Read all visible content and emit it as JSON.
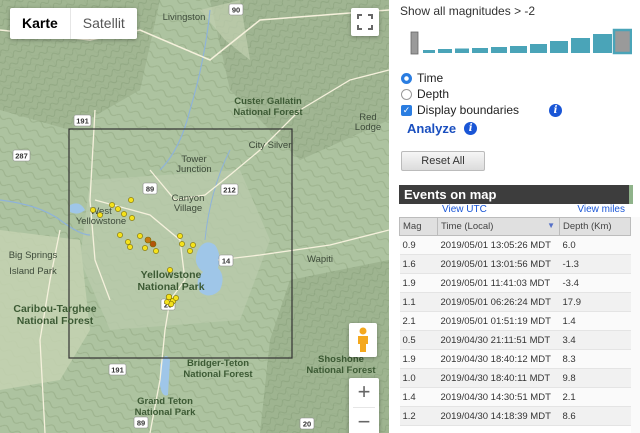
{
  "map": {
    "map_type_buttons": [
      "Karte",
      "Satellit"
    ],
    "active_map_type": "Karte",
    "labels": [
      {
        "name": "livingston",
        "text": "Livingston"
      },
      {
        "name": "gallatin",
        "text": "Custer Gallatin\nNational Forest"
      },
      {
        "name": "red-lodge",
        "text": "Red\nLodge"
      },
      {
        "name": "city-silver",
        "text": "City Silver"
      },
      {
        "name": "tower-junction",
        "text": "Tower\nJunction"
      },
      {
        "name": "canyon-village",
        "text": "Canyon\nVillage"
      },
      {
        "name": "west-yellowstone",
        "text": "West\nYellowstone"
      },
      {
        "name": "big-springs",
        "text": "Big Springs"
      },
      {
        "name": "island-park",
        "text": "Island Park"
      },
      {
        "name": "yellowstone-np",
        "text": "Yellowstone\nNational Park"
      },
      {
        "name": "caribou-targhee",
        "text": "Caribou-Targhee\nNational Forest"
      },
      {
        "name": "wapiti",
        "text": "Wapiti"
      },
      {
        "name": "shoshone",
        "text": "Shoshone\nNational Forest"
      },
      {
        "name": "bridger-teton",
        "text": "Bridger-Teton\nNational Forest"
      },
      {
        "name": "grand-teton",
        "text": "Grand Teton\nNational Park"
      }
    ],
    "shields": [
      "90",
      "191",
      "287",
      "89",
      "212",
      "14",
      "20",
      "191",
      "89",
      "20",
      "287"
    ],
    "zoom_in": "+",
    "zoom_out": "−"
  },
  "panel": {
    "magnitude_title": "Show all magnitudes > -2",
    "sort_options": [
      {
        "label": "Time",
        "selected": true
      },
      {
        "label": "Depth",
        "selected": false
      }
    ],
    "display_boundaries_label": "Display boundaries",
    "display_boundaries_checked": true,
    "analyze_label": "Analyze",
    "reset_label": "Reset All",
    "events_title": "Events on map",
    "view_utc": "View UTC",
    "view_miles": "View miles",
    "columns": [
      "Mag",
      "Time (Local)",
      "Depth (Km)"
    ],
    "rows": [
      {
        "mag": "0.9",
        "time": "2019/05/01 13:05:26 MDT",
        "depth": "6.0"
      },
      {
        "mag": "1.6",
        "time": "2019/05/01 13:01:56 MDT",
        "depth": "-1.3"
      },
      {
        "mag": "1.9",
        "time": "2019/05/01 11:41:03 MDT",
        "depth": "-3.4"
      },
      {
        "mag": "1.1",
        "time": "2019/05/01 06:26:24 MDT",
        "depth": "17.9"
      },
      {
        "mag": "2.1",
        "time": "2019/05/01 01:51:19 MDT",
        "depth": "1.4"
      },
      {
        "mag": "0.5",
        "time": "2019/04/30 21:11:51 MDT",
        "depth": "3.4"
      },
      {
        "mag": "1.9",
        "time": "2019/04/30 18:40:12 MDT",
        "depth": "8.3"
      },
      {
        "mag": "1.0",
        "time": "2019/04/30 18:40:11 MDT",
        "depth": "9.8"
      },
      {
        "mag": "1.4",
        "time": "2019/04/30 14:30:51 MDT",
        "depth": "2.1"
      },
      {
        "mag": "1.2",
        "time": "2019/04/30 14:18:39 MDT",
        "depth": "8.6"
      }
    ]
  }
}
